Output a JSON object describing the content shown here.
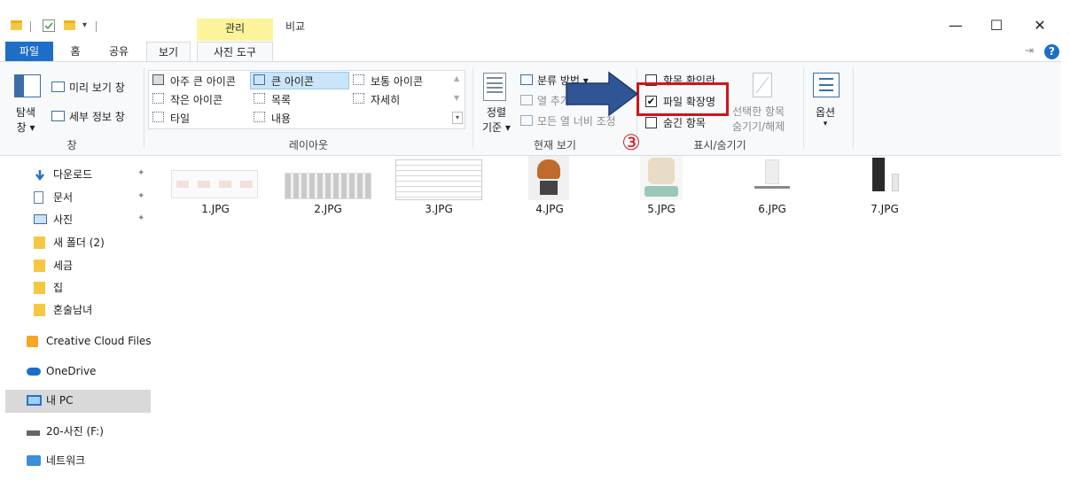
{
  "titlebar": {
    "context_tab": "관리",
    "title": "비교",
    "minimize": "—",
    "maximize": "☐",
    "close": "✕"
  },
  "tabs": {
    "file": "파일",
    "home": "홈",
    "share": "공유",
    "view": "보기",
    "picture_tools": "사진 도구"
  },
  "ribbon": {
    "nav_pane": "탐색\n창",
    "nav_pane_line1": "탐색",
    "nav_pane_line2": "창 ▾",
    "preview_pane": "미리 보기 창",
    "details_pane": "세부 정보 창",
    "panes_group": "창",
    "layout_items": [
      "아주 큰 아이콘",
      "큰 아이콘",
      "보통 아이콘",
      "작은 아이콘",
      "목록",
      "자세히",
      "타일",
      "내용"
    ],
    "layout_group": "레이아웃",
    "sort_line1": "정렬",
    "sort_line2": "기준 ▾",
    "group_by": "분류 방법 ▾",
    "add_columns": "열 추가",
    "size_all_columns": "모든 열 너비 조정",
    "current_view_group": "현재 보기",
    "item_checkboxes": "항목 확인란",
    "file_extensions": "파일 확장명",
    "hidden_items": "숨긴 항목",
    "hide_selected_line1": "선택한 항목",
    "hide_selected_line2": "숨기기/해제",
    "show_hide_group": "표시/숨기기",
    "options": "옵션",
    "file_extensions_checked": true
  },
  "annotation": {
    "step_number": "③"
  },
  "nav": {
    "items": [
      {
        "label": "다운로드",
        "pinned": true
      },
      {
        "label": "문서",
        "pinned": true
      },
      {
        "label": "사진",
        "pinned": true
      },
      {
        "label": "새 폴더 (2)",
        "pinned": false
      },
      {
        "label": "세금",
        "pinned": false
      },
      {
        "label": "집",
        "pinned": false
      },
      {
        "label": "혼술남녀",
        "pinned": false
      },
      {
        "label": "Creative Cloud Files",
        "pinned": false
      },
      {
        "label": "OneDrive",
        "pinned": false
      },
      {
        "label": "내 PC",
        "pinned": false
      },
      {
        "label": "20-사진 (F:)",
        "pinned": false
      },
      {
        "label": "네트워크",
        "pinned": false
      }
    ],
    "pin_glyph": "📌"
  },
  "files": [
    {
      "name": "1.JPG"
    },
    {
      "name": "2.JPG"
    },
    {
      "name": "3.JPG"
    },
    {
      "name": "4.JPG"
    },
    {
      "name": "5.JPG"
    },
    {
      "name": "6.JPG"
    },
    {
      "name": "7.JPG"
    }
  ],
  "colors": {
    "file_tab": "#1e6ec8",
    "context_tab": "#fdf39a",
    "highlight_red": "#d0151b",
    "arrow_blue": "#2f5597",
    "selected_nav": "#d9d9d9"
  }
}
